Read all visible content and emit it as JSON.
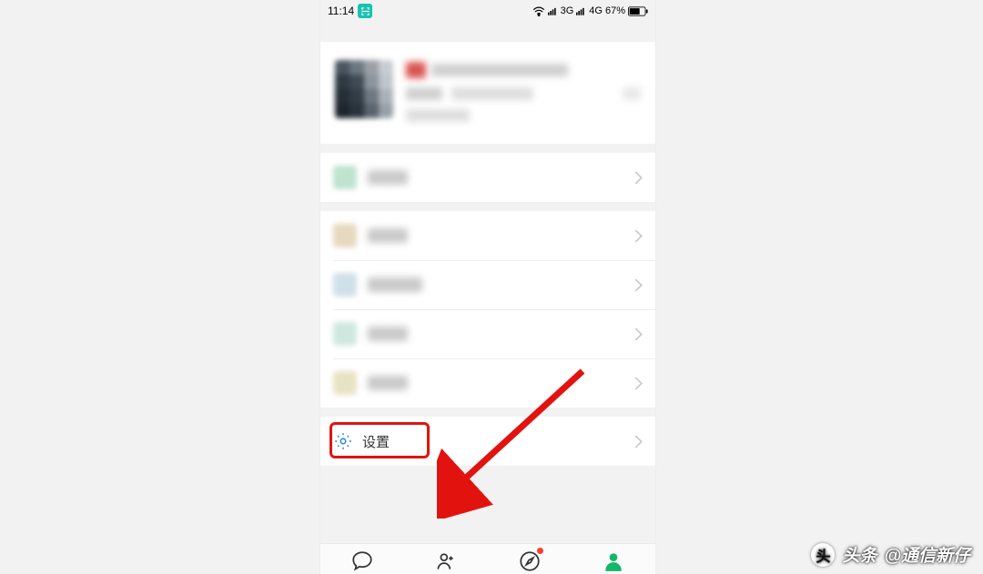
{
  "statusbar": {
    "time": "11:14",
    "net1": "3G",
    "net2": "4G",
    "battery": "67%"
  },
  "settings": {
    "label": "设置"
  },
  "watermark": {
    "prefix": "头条",
    "handle": "@通信新仔",
    "logo_glyph": "头"
  },
  "tabs": {
    "chat": "chat",
    "contacts": "contacts",
    "discover": "discover",
    "me": "me"
  }
}
